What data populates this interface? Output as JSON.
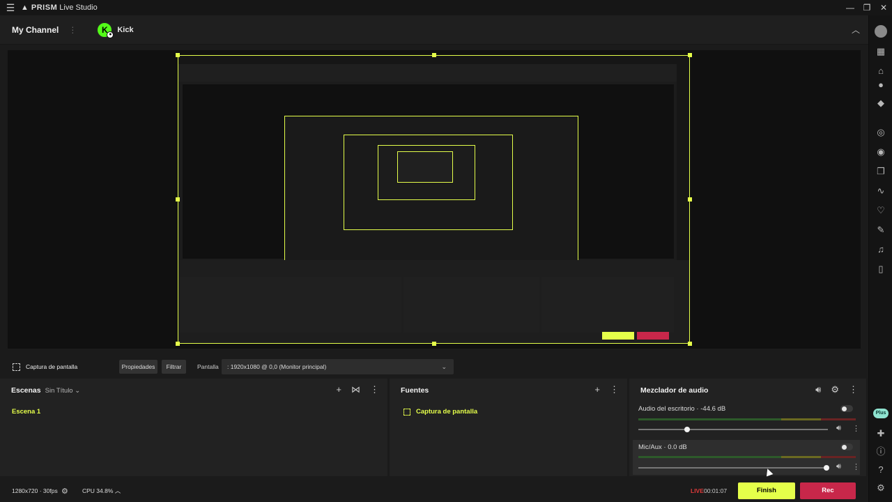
{
  "app": {
    "title_brand": "PRISM",
    "title_rest": "Live Studio"
  },
  "channel": {
    "label": "My Channel",
    "platform": "Kick",
    "platform_initial": "K"
  },
  "toolbar": {
    "source_name": "Captura de pantalla",
    "properties": "Propiedades",
    "filter": "Filtrar",
    "display_label": "Pantalla",
    "display_value": ": 1920x1080 @ 0,0 (Monitor principal)"
  },
  "scenes": {
    "title": "Escenas",
    "collection": "Sin Título",
    "items": [
      "Escena 1"
    ]
  },
  "sources": {
    "title": "Fuentes",
    "items": [
      "Captura de pantalla"
    ]
  },
  "mixer": {
    "title": "Mezclador de audio",
    "channels": [
      {
        "name": "Audio del escritorio",
        "level": "-44.6 dB"
      },
      {
        "name": "Mic/Aux",
        "level": "0.0 dB"
      }
    ]
  },
  "status": {
    "resolution": "1280x720 · 30fps",
    "cpu": "CPU 34.8%",
    "live": "LIVE",
    "time": "00:01:07",
    "finish": "Finish",
    "rec": "Rec"
  },
  "sidebar": {
    "plus_label": "Plus"
  },
  "colors": {
    "accent": "#e5ff4a",
    "rec": "#c8274a",
    "kick": "#53fc18",
    "live": "#e03a3a"
  }
}
